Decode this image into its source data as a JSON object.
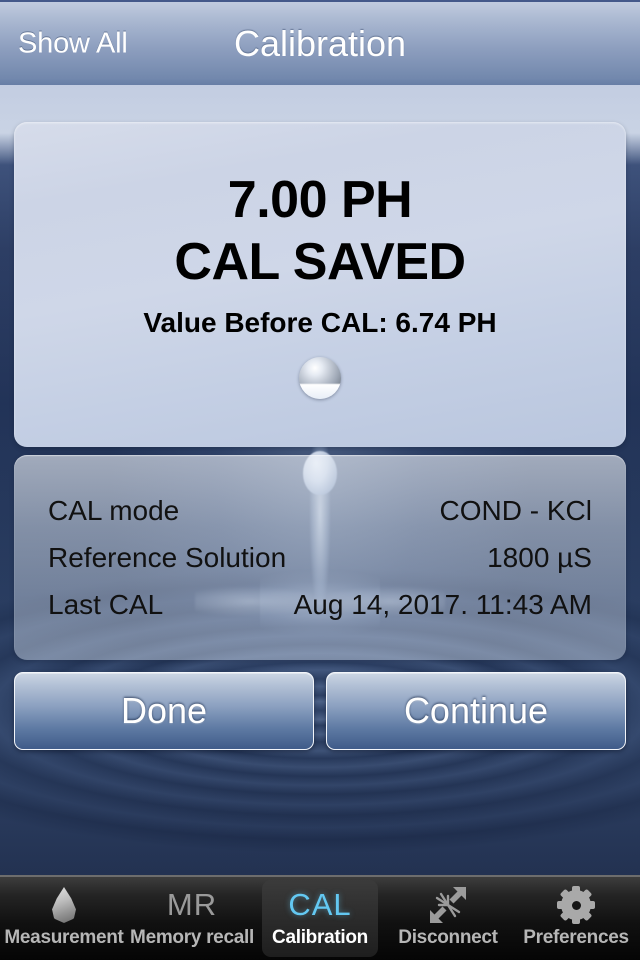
{
  "navbar": {
    "back_label": "Show All",
    "title": "Calibration"
  },
  "result": {
    "value_line": "7.00 PH",
    "status_line": "CAL SAVED",
    "before_label": "Value Before CAL: 6.74 PH",
    "indicator_icon": "water-droplet-bubble-icon"
  },
  "info": {
    "rows": [
      {
        "label": "CAL mode",
        "value": "COND - KCl"
      },
      {
        "label": "Reference Solution",
        "value": "1800 µS"
      },
      {
        "label": "Last CAL",
        "value": "Aug 14, 2017. 11:43 AM"
      }
    ]
  },
  "actions": {
    "done_label": "Done",
    "continue_label": "Continue"
  },
  "tabbar": {
    "items": [
      {
        "label": "Measurement",
        "icon": "water-drop-icon",
        "glyph": "",
        "active": false
      },
      {
        "label": "Memory recall",
        "icon": "mr-text-icon",
        "glyph": "MR",
        "active": false
      },
      {
        "label": "Calibration",
        "icon": "cal-text-icon",
        "glyph": "CAL",
        "active": true
      },
      {
        "label": "Disconnect",
        "icon": "disconnect-icon",
        "glyph": "",
        "active": false
      },
      {
        "label": "Preferences",
        "icon": "gear-icon",
        "glyph": "",
        "active": false
      }
    ]
  },
  "colors": {
    "navbar_top": "#c1cbdf",
    "navbar_bottom": "#7288ad",
    "accent_cal": "#63c8f2",
    "card_bg": "#ccd4e6",
    "background_deep": "#1b2b4e"
  }
}
